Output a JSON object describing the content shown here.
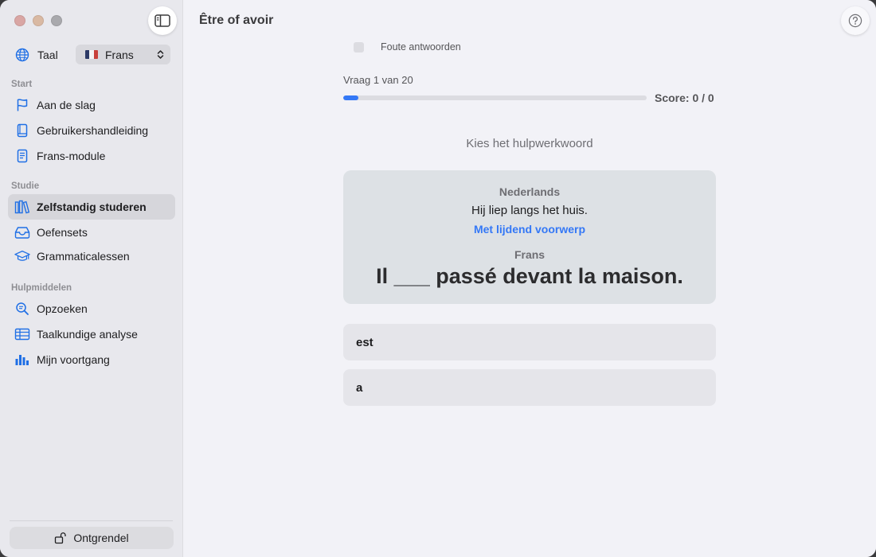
{
  "sidebar": {
    "language_label": "Taal",
    "language_value": "Frans",
    "sections": [
      {
        "header": "Start",
        "items": [
          {
            "label": "Aan de slag",
            "icon": "flag-icon"
          },
          {
            "label": "Gebruikershandleiding",
            "icon": "book-icon"
          },
          {
            "label": "Frans-module",
            "icon": "document-icon"
          }
        ]
      },
      {
        "header": "Studie",
        "items": [
          {
            "label": "Zelfstandig studeren",
            "icon": "books-icon",
            "active": true
          },
          {
            "label": "Oefensets",
            "icon": "tray-icon"
          },
          {
            "label": "Grammaticalessen",
            "icon": "graduation-cap-icon"
          }
        ]
      },
      {
        "header": "Hulpmiddelen",
        "items": [
          {
            "label": "Opzoeken",
            "icon": "magnifier-icon"
          },
          {
            "label": "Taalkundige analyse",
            "icon": "table-icon"
          },
          {
            "label": "Mijn voortgang",
            "icon": "bar-chart-icon"
          }
        ]
      }
    ],
    "unlock_label": "Ontgrendel"
  },
  "main": {
    "title": "Être of avoir",
    "wrong_answers_label": "Foute antwoorden",
    "progress_label": "Vraag 1 van 20",
    "progress_fraction": 0.05,
    "score_label": "Score: 0 / 0",
    "instruction": "Kies het hulpwerkwoord",
    "card": {
      "source_language": "Nederlands",
      "source_sentence": "Hij liep langs het huis.",
      "hint": "Met lijdend voorwerp",
      "target_language": "Frans",
      "target_sentence": "Il ___ passé devant la maison."
    },
    "options": [
      "est",
      "a"
    ]
  },
  "colors": {
    "accent": "#3478f6",
    "sidebar_bg": "#e8e8ed",
    "main_bg": "#f2f2f7",
    "card_bg": "#dde1e5"
  }
}
